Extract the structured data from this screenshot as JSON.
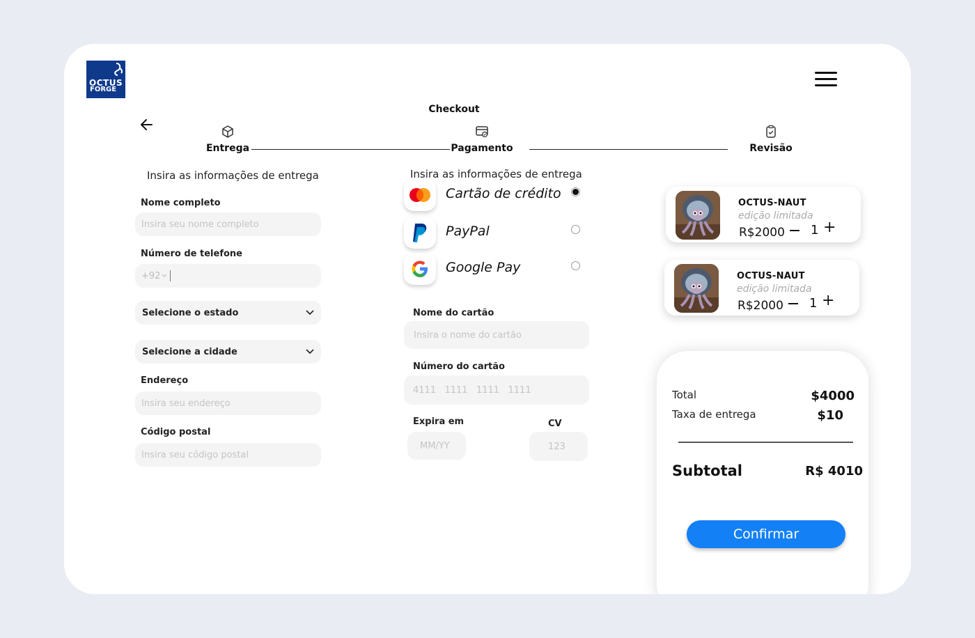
{
  "brand": {
    "line1": "OCTUS",
    "line2": "FORGE",
    "color": "#0f3a8c"
  },
  "header": {
    "title": "Checkout"
  },
  "steps": [
    {
      "label": "Entrega",
      "icon": "box-icon"
    },
    {
      "label": "Pagamento",
      "icon": "payment-card-icon"
    },
    {
      "label": "Revisão",
      "icon": "clipboard-check-icon"
    }
  ],
  "delivery": {
    "title": "Insira as informações de entrega",
    "name_label": "Nome completo",
    "name_placeholder": "Insira seu nome completo",
    "phone_label": "Número de telefone",
    "phone_prefix": "+92",
    "state_select": "Selecione o estado",
    "city_select": "Selecione a cidade",
    "address_label": "Endereço",
    "address_placeholder": "Insira seu endereço",
    "postal_label": "Código postal",
    "postal_placeholder": "Insira seu código postal"
  },
  "payment": {
    "title": "Insira as informações de entrega",
    "methods": [
      {
        "label": "Cartão de crédito",
        "selected": true,
        "icon": "mastercard-icon"
      },
      {
        "label": "PayPal",
        "selected": false,
        "icon": "paypal-icon"
      },
      {
        "label": "Google Pay",
        "selected": false,
        "icon": "google-icon"
      }
    ],
    "card_name_label": "Nome do cartão",
    "card_name_placeholder": "Insira o nome do cartão",
    "card_number_label": "Número do cartão",
    "card_number_placeholder": "4111   1111   1111   1111",
    "expiry_label": "Expira em",
    "expiry_placeholder": "MM/YY",
    "cvv_label": "CV",
    "cvv_placeholder": "123"
  },
  "cart": [
    {
      "name": "OCTUS-NAUT",
      "subtitle": "edição limitada",
      "price": "R$2000",
      "qty": "1"
    },
    {
      "name": "OCTUS-NAUT",
      "subtitle": "edição limitada",
      "price": "R$2000",
      "qty": "1"
    }
  ],
  "summary": {
    "total_label": "Total",
    "total_value": "$4000",
    "delivery_label": "Taxa de entrega",
    "delivery_value": "$10",
    "subtotal_label": "Subtotal",
    "subtotal_value": "R$ 4010",
    "confirm_label": "Confirmar",
    "accent": "#1380f5"
  }
}
